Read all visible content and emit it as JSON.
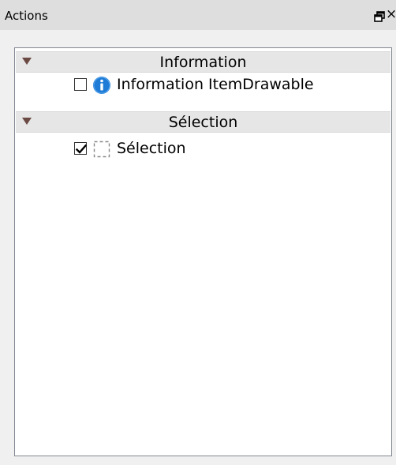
{
  "panel": {
    "title": "Actions",
    "float_icon": "float-window-icon",
    "close_glyph": "×"
  },
  "groups": [
    {
      "label": "Information",
      "expanded": true,
      "items": [
        {
          "label": "Information ItemDrawable",
          "checked": false,
          "icon": "info-icon"
        }
      ]
    },
    {
      "label": "Sélection",
      "expanded": true,
      "items": [
        {
          "label": "Sélection",
          "checked": true,
          "icon": "selection-marquee-icon"
        }
      ]
    }
  ],
  "colors": {
    "info_blue": "#1e7bd6",
    "header_bg": "#e6e6e6",
    "arrow": "#6b4a44"
  }
}
